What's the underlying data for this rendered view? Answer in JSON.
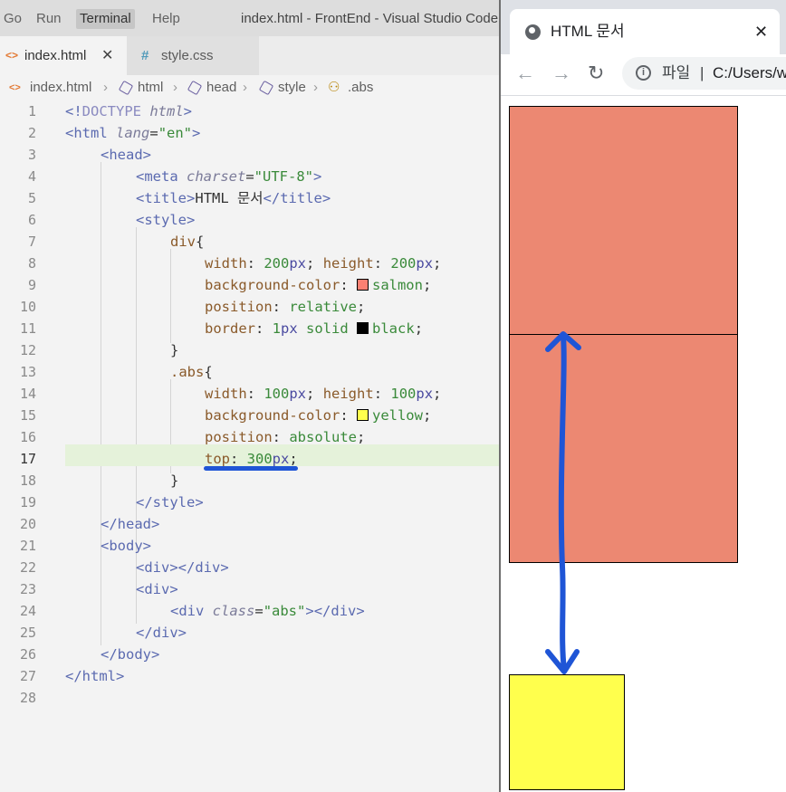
{
  "vscode": {
    "menu": [
      "Go",
      "Run",
      "Terminal",
      "Help"
    ],
    "active_menu": "Terminal",
    "window_title": "index.html - FrontEnd - Visual Studio Code",
    "tabs": [
      {
        "label": "index.html",
        "icon": "html-file-icon",
        "active": true
      },
      {
        "label": "style.css",
        "icon": "css-file-icon",
        "active": false
      }
    ],
    "breadcrumb": [
      "index.html",
      "html",
      "head",
      "style",
      ".abs"
    ],
    "active_line": 17,
    "line_numbers": [
      "1",
      "2",
      "3",
      "4",
      "5",
      "6",
      "7",
      "8",
      "9",
      "10",
      "11",
      "12",
      "13",
      "14",
      "15",
      "16",
      "17",
      "18",
      "19",
      "20",
      "21",
      "22",
      "23",
      "24",
      "25",
      "26",
      "27",
      "28"
    ],
    "code": {
      "l1": [
        "<!",
        "DOCTYPE",
        " html",
        ">"
      ],
      "l2": [
        "<",
        "html",
        " lang",
        "=",
        "\"en\"",
        ">"
      ],
      "l3": [
        "<",
        "head",
        ">"
      ],
      "l4": [
        "<",
        "meta",
        " charset",
        "=",
        "\"UTF-8\"",
        ">"
      ],
      "l5": [
        "<",
        "title",
        ">",
        "HTML 문서",
        "</",
        "title",
        ">"
      ],
      "l6": [
        "<",
        "style",
        ">"
      ],
      "l7": [
        "div",
        "{"
      ],
      "l8": [
        "width",
        ": ",
        "200",
        "px",
        "; ",
        "height",
        ": ",
        "200",
        "px",
        ";"
      ],
      "l9": [
        "background-color",
        ": ",
        "salmon",
        ";"
      ],
      "l10": [
        "position",
        ": ",
        "relative",
        ";"
      ],
      "l11": [
        "border",
        ": ",
        "1",
        "px",
        " solid ",
        "black",
        ";"
      ],
      "l12": [
        "}"
      ],
      "l13": [
        ".abs",
        "{"
      ],
      "l14": [
        "width",
        ": ",
        "100",
        "px",
        "; ",
        "height",
        ": ",
        "100",
        "px",
        ";"
      ],
      "l15": [
        "background-color",
        ": ",
        "yellow",
        ";"
      ],
      "l16": [
        "position",
        ": ",
        "absolute",
        ";"
      ],
      "l17": [
        "top",
        ": ",
        "300",
        "px",
        ";"
      ],
      "l18": [
        "}"
      ],
      "l19": [
        "</",
        "style",
        ">"
      ],
      "l20": [
        "</",
        "head",
        ">"
      ],
      "l21": [
        "<",
        "body",
        ">"
      ],
      "l22": [
        "<",
        "div",
        "></",
        "div",
        ">"
      ],
      "l23": [
        "<",
        "div",
        ">"
      ],
      "l24": [
        "<",
        "div",
        " class",
        "=",
        "\"abs\"",
        "></",
        "div",
        ">"
      ],
      "l25": [
        "</",
        "div",
        ">"
      ],
      "l26": [
        "</",
        "body",
        ">"
      ],
      "l27": [
        "</",
        "html",
        ">"
      ]
    },
    "swatches": {
      "salmon": "#fa8072",
      "black": "#000000",
      "yellow": "#ffff00"
    }
  },
  "browser": {
    "tab_title": "HTML 문서",
    "tab_close": "✕",
    "omnibox_scheme": "파일",
    "omnibox_separator": "|",
    "omnibox_url": "C:/Users/w",
    "demo": {
      "box_color": "#ec8872",
      "abs_box_color": "#ffff4d",
      "annotation_color": "#1f55d6"
    }
  },
  "icons": {
    "back": "arrow-left-icon",
    "forward": "arrow-right-icon",
    "reload": "reload-icon",
    "info": "info-icon",
    "globe": "globe-icon",
    "close": "close-icon"
  }
}
